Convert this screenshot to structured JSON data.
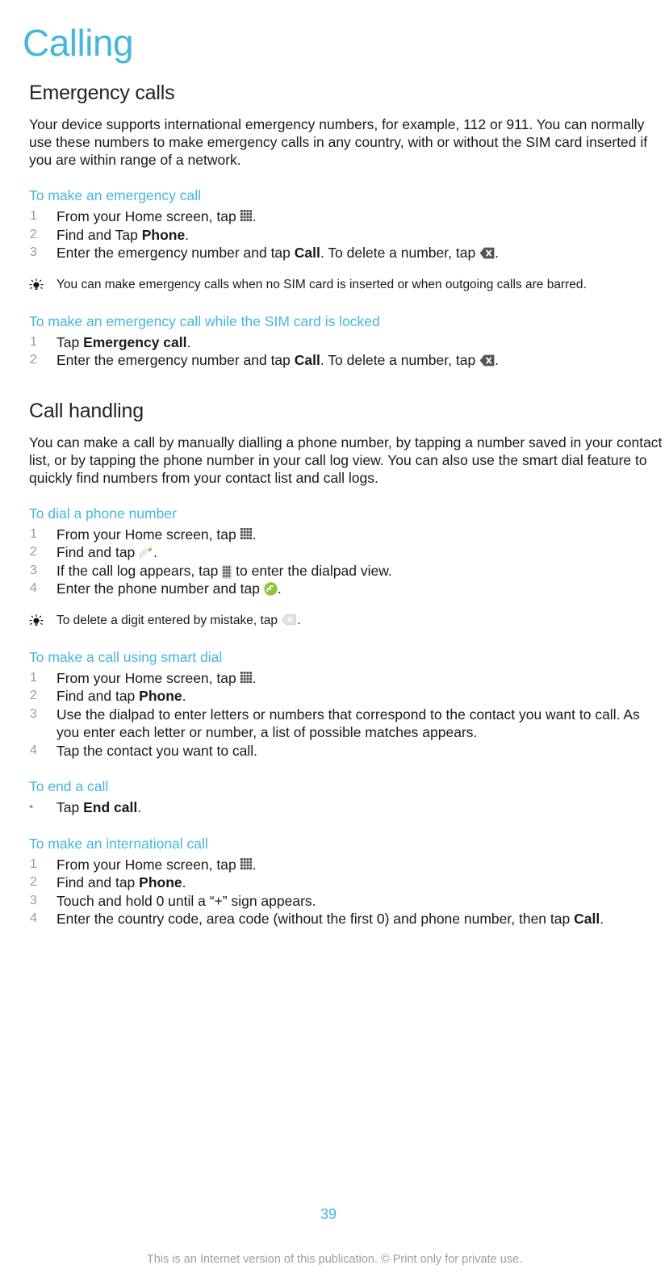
{
  "document": {
    "chapter_title": "Calling",
    "page_number": "39",
    "footer_note": "This is an Internet version of this publication. © Print only for private use."
  },
  "colors": {
    "accent": "#45b7dd",
    "body_text": "#1a1a1a",
    "step_number": "#9a9a9a",
    "footer": "#9d9d9d",
    "call_green": "#8cc63f",
    "key_gray": "#555555"
  },
  "sections": [
    {
      "heading": "Emergency calls",
      "paragraphs": [
        "Your device supports international emergency numbers, for example, 112 or 911. You can normally use these numbers to make emergency calls in any country, with or without the SIM card inserted if you are within range of a network."
      ],
      "procedures": [
        {
          "title": "To make an emergency call",
          "steps": [
            {
              "number": "1",
              "parts": [
                {
                  "type": "text",
                  "value": "From your Home screen, tap "
                },
                {
                  "type": "icon",
                  "icon": "app-drawer-grid-icon"
                },
                {
                  "type": "text",
                  "value": "."
                }
              ]
            },
            {
              "number": "2",
              "parts": [
                {
                  "type": "text",
                  "value": "Find and Tap "
                },
                {
                  "type": "bold",
                  "value": "Phone"
                },
                {
                  "type": "text",
                  "value": "."
                }
              ]
            },
            {
              "number": "3",
              "parts": [
                {
                  "type": "text",
                  "value": "Enter the emergency number and tap "
                },
                {
                  "type": "bold",
                  "value": "Call"
                },
                {
                  "type": "text",
                  "value": ". To delete a number, tap "
                },
                {
                  "type": "icon",
                  "icon": "backspace-dark-key-icon"
                },
                {
                  "type": "text",
                  "value": "."
                }
              ]
            }
          ],
          "tip": "You can make emergency calls when no SIM card is inserted or when outgoing calls are barred."
        },
        {
          "title": "To make an emergency call while the SIM card is locked",
          "steps": [
            {
              "number": "1",
              "parts": [
                {
                  "type": "text",
                  "value": "Tap "
                },
                {
                  "type": "bold",
                  "value": "Emergency call"
                },
                {
                  "type": "text",
                  "value": "."
                }
              ]
            },
            {
              "number": "2",
              "parts": [
                {
                  "type": "text",
                  "value": "Enter the emergency number and tap "
                },
                {
                  "type": "bold",
                  "value": "Call"
                },
                {
                  "type": "text",
                  "value": ". To delete a number, tap "
                },
                {
                  "type": "icon",
                  "icon": "backspace-dark-key-icon"
                },
                {
                  "type": "text",
                  "value": "."
                }
              ]
            }
          ],
          "tip": null
        }
      ]
    },
    {
      "heading": "Call handling",
      "paragraphs": [
        "You can make a call by manually dialling a phone number, by tapping a number saved in your contact list, or by tapping the phone number in your call log view. You can also use the smart dial feature to quickly find numbers from your contact list and call logs."
      ],
      "procedures": [
        {
          "title": "To dial a phone number",
          "steps": [
            {
              "number": "1",
              "parts": [
                {
                  "type": "text",
                  "value": "From your Home screen, tap "
                },
                {
                  "type": "icon",
                  "icon": "app-drawer-grid-icon"
                },
                {
                  "type": "text",
                  "value": "."
                }
              ]
            },
            {
              "number": "2",
              "parts": [
                {
                  "type": "text",
                  "value": "Find and tap "
                },
                {
                  "type": "icon",
                  "icon": "phone-handset-icon"
                },
                {
                  "type": "text",
                  "value": "."
                }
              ]
            },
            {
              "number": "3",
              "parts": [
                {
                  "type": "text",
                  "value": "If the call log appears, tap "
                },
                {
                  "type": "icon",
                  "icon": "dialpad-icon"
                },
                {
                  "type": "text",
                  "value": " to enter the dialpad view."
                }
              ]
            },
            {
              "number": "4",
              "parts": [
                {
                  "type": "text",
                  "value": "Enter the phone number and tap "
                },
                {
                  "type": "icon",
                  "icon": "green-call-button-icon"
                },
                {
                  "type": "text",
                  "value": "."
                }
              ]
            }
          ],
          "tip_parts": [
            {
              "type": "text",
              "value": "To delete a digit entered by mistake, tap "
            },
            {
              "type": "icon",
              "icon": "backspace-light-key-icon"
            },
            {
              "type": "text",
              "value": "."
            }
          ]
        },
        {
          "title": "To make a call using smart dial",
          "steps": [
            {
              "number": "1",
              "parts": [
                {
                  "type": "text",
                  "value": "From your Home screen, tap "
                },
                {
                  "type": "icon",
                  "icon": "app-drawer-grid-icon"
                },
                {
                  "type": "text",
                  "value": "."
                }
              ]
            },
            {
              "number": "2",
              "parts": [
                {
                  "type": "text",
                  "value": "Find and tap "
                },
                {
                  "type": "bold",
                  "value": "Phone"
                },
                {
                  "type": "text",
                  "value": "."
                }
              ]
            },
            {
              "number": "3",
              "parts": [
                {
                  "type": "text",
                  "value": "Use the dialpad to enter letters or numbers that correspond to the contact you want to call. As you enter each letter or number, a list of possible matches appears."
                }
              ]
            },
            {
              "number": "4",
              "parts": [
                {
                  "type": "text",
                  "value": "Tap the contact you want to call."
                }
              ]
            }
          ],
          "tip": null
        },
        {
          "title": "To end a call",
          "steps": [
            {
              "bullet": true,
              "parts": [
                {
                  "type": "text",
                  "value": "Tap "
                },
                {
                  "type": "bold",
                  "value": "End call"
                },
                {
                  "type": "text",
                  "value": "."
                }
              ]
            }
          ],
          "tip": null
        },
        {
          "title": "To make an international call",
          "steps": [
            {
              "number": "1",
              "parts": [
                {
                  "type": "text",
                  "value": "From your Home screen, tap "
                },
                {
                  "type": "icon",
                  "icon": "app-drawer-grid-icon"
                },
                {
                  "type": "text",
                  "value": "."
                }
              ]
            },
            {
              "number": "2",
              "parts": [
                {
                  "type": "text",
                  "value": "Find and tap "
                },
                {
                  "type": "bold",
                  "value": "Phone"
                },
                {
                  "type": "text",
                  "value": "."
                }
              ]
            },
            {
              "number": "3",
              "parts": [
                {
                  "type": "text",
                  "value": "Touch and hold 0 until a “+” sign appears."
                }
              ]
            },
            {
              "number": "4",
              "parts": [
                {
                  "type": "text",
                  "value": "Enter the country code, area code (without the first 0) and phone number, then tap "
                },
                {
                  "type": "bold",
                  "value": "Call"
                },
                {
                  "type": "text",
                  "value": "."
                }
              ]
            }
          ],
          "tip": null
        }
      ]
    }
  ]
}
